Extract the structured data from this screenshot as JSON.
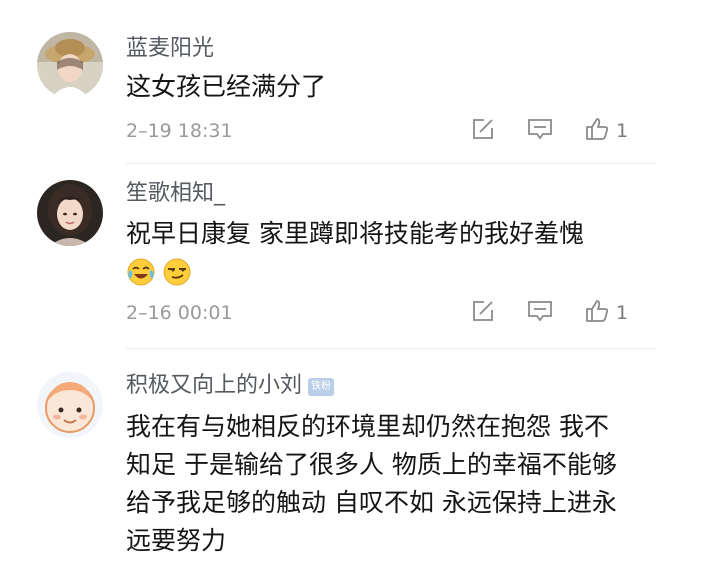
{
  "comments": [
    {
      "username": "蓝麦阳光",
      "text_lines": [
        "这女孩已经满分了"
      ],
      "time": "2–19 18:31",
      "likes": "1"
    },
    {
      "username": "笙歌相知_",
      "text_lines": [
        "祝早日康复 家里蹲即将技能考的我好羞愧"
      ],
      "emojis": [
        "laughing-crying-emoji",
        "smirk-emoji"
      ],
      "time": "2–16 00:01",
      "likes": "1"
    },
    {
      "username": "积极又向上的小刘",
      "badge": "铁粉",
      "text_lines": [
        "我在有与她相反的环境里却仍然在抱怨 我不",
        "知足 于是输给了很多人 物质上的幸福不能够",
        "给予我足够的触动 自叹不如  永远保持上进永",
        "远要努力"
      ]
    }
  ],
  "icons": {
    "share": "share-icon",
    "comment": "comment-icon",
    "like": "thumbs-up-icon"
  },
  "colors": {
    "username": "#555a61",
    "text": "#151515",
    "meta": "#9a9a9a",
    "badge": "#b9cfe8"
  }
}
